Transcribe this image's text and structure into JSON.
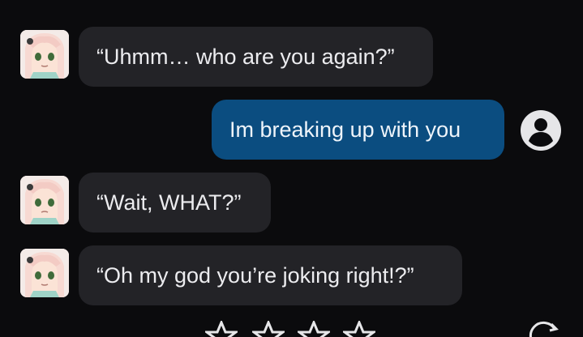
{
  "messages": [
    {
      "role": "bot",
      "text": "“Uhmm… who are you again?”"
    },
    {
      "role": "user",
      "text": "Im breaking up with you"
    },
    {
      "role": "bot",
      "text": "“Wait, WHAT?”"
    },
    {
      "role": "bot",
      "text": "“Oh my god you’re joking right!?”"
    }
  ],
  "icons": {
    "bot_avatar": "anime-character-avatar",
    "user_avatar": "user-circle-icon",
    "rating": "star-icon",
    "regenerate": "regenerate-icon"
  },
  "colors": {
    "background": "#0b0b0d",
    "bot_bubble": "#232327",
    "user_bubble": "#0b4d80",
    "text": "#ececef"
  }
}
